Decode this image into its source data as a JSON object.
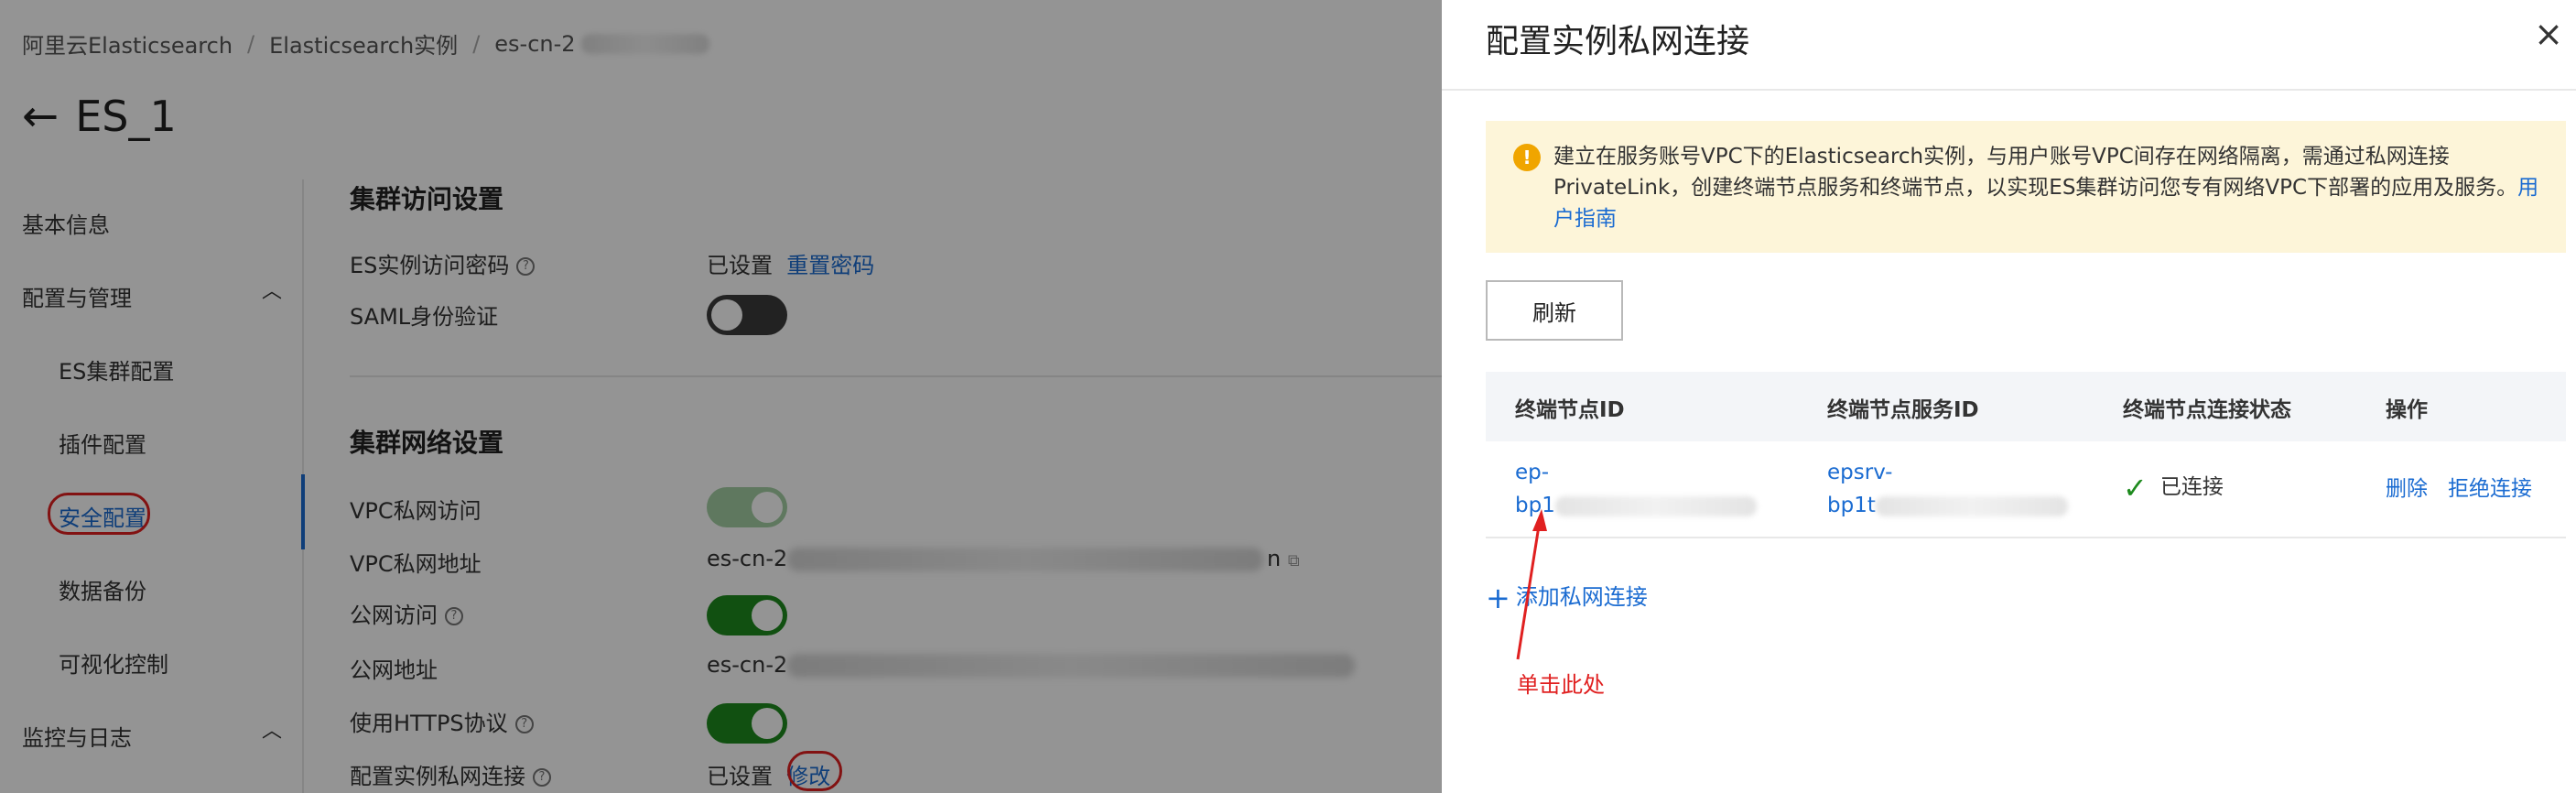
{
  "breadcrumb": [
    "阿里云Elasticsearch",
    "Elasticsearch实例",
    "es-cn-2"
  ],
  "page_title": "ES_1",
  "sidebar": {
    "items": [
      {
        "label": "基本信息"
      },
      {
        "label": "配置与管理",
        "expanded": true
      },
      {
        "label": "ES集群配置"
      },
      {
        "label": "插件配置"
      },
      {
        "label": "安全配置",
        "active": true
      },
      {
        "label": "数据备份"
      },
      {
        "label": "可视化控制"
      },
      {
        "label": "监控与日志",
        "expanded": true
      }
    ]
  },
  "access": {
    "title": "集群访问设置",
    "password_label": "ES实例访问密码",
    "password_status": "已设置",
    "password_link": "重置密码",
    "saml_label": "SAML身份验证",
    "saml_on": false
  },
  "network": {
    "title": "集群网络设置",
    "vpc_access_label": "VPC私网访问",
    "vpc_access_on": true,
    "vpc_address_label": "VPC私网地址",
    "vpc_address_value": "es-cn-2",
    "vpc_address_suffix": "n",
    "public_access_label": "公网访问",
    "public_access_on": true,
    "public_address_label": "公网地址",
    "public_address_value": "es-cn-2",
    "https_label": "使用HTTPS协议",
    "https_on": true,
    "private_conn_label": "配置实例私网连接",
    "private_conn_status": "已设置",
    "private_conn_link": "修改"
  },
  "drawer": {
    "title": "配置实例私网连接",
    "close": "×",
    "notice_text": "建立在服务账号VPC下的Elasticsearch实例，与用户账号VPC间存在网络隔离，需通过私网连接PrivateLink，创建终端节点服务和终端节点，以实现ES集群访问您专有网络VPC下部署的应用及服务。",
    "notice_link": "用户指南",
    "refresh": "刷新",
    "columns": [
      "终端节点ID",
      "终端节点服务ID",
      "终端节点连接状态",
      "操作"
    ],
    "rows": [
      {
        "endpoint_id_line1": "ep-",
        "endpoint_id_line2": "bp1",
        "service_id_line1": "epsrv-",
        "service_id_line2": "bp1t",
        "status": "已连接",
        "actions": [
          "删除",
          "拒绝连接"
        ]
      }
    ],
    "add_link": "添加私网连接",
    "annotation": "单击此处"
  },
  "colors": {
    "link": "#1a6bd1",
    "toggle_on": "#1e8a1e",
    "annotation": "#e02020",
    "notice_bg": "#fdf5d9"
  }
}
